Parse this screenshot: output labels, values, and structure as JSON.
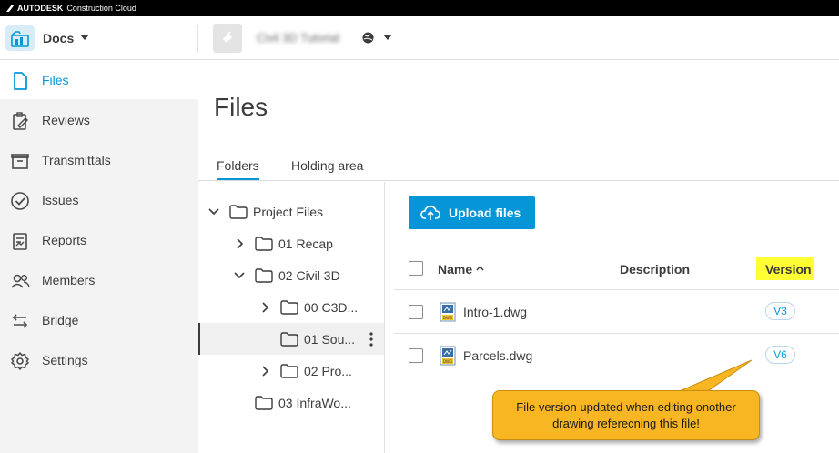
{
  "topbar": {
    "brand": "AUTODESK",
    "product": "Construction Cloud"
  },
  "header": {
    "module": "Docs",
    "project": "Civil 3D Tutorial"
  },
  "sidebar": {
    "items": [
      {
        "label": "Files",
        "icon": "file-icon",
        "active": true
      },
      {
        "label": "Reviews",
        "icon": "reviews-icon"
      },
      {
        "label": "Transmittals",
        "icon": "transmittals-icon"
      },
      {
        "label": "Issues",
        "icon": "issues-icon"
      },
      {
        "label": "Reports",
        "icon": "reports-icon"
      },
      {
        "label": "Members",
        "icon": "members-icon"
      },
      {
        "label": "Bridge",
        "icon": "bridge-icon"
      },
      {
        "label": "Settings",
        "icon": "settings-icon"
      }
    ]
  },
  "main": {
    "title": "Files",
    "tabs": [
      {
        "label": "Folders",
        "active": true
      },
      {
        "label": "Holding area"
      }
    ],
    "upload_label": "Upload files"
  },
  "tree": [
    {
      "label": "Project Files",
      "expanded": true
    },
    {
      "label": "01 Recap",
      "expanded": false
    },
    {
      "label": "02 Civil 3D",
      "expanded": true
    },
    {
      "label": "00 C3D...",
      "expanded": false
    },
    {
      "label": "01 Sou...",
      "selected": true
    },
    {
      "label": "02 Pro...",
      "expanded": false
    },
    {
      "label": "03 InfraWo..."
    }
  ],
  "table": {
    "columns": {
      "name": "Name",
      "description": "Description",
      "version": "Version"
    },
    "rows": [
      {
        "name": "Intro-1.dwg",
        "version": "V3"
      },
      {
        "name": "Parcels.dwg",
        "version": "V6"
      }
    ]
  },
  "callout": {
    "text": "File version updated when editing onother drawing referecning this file!"
  },
  "colors": {
    "accent": "#0696d7",
    "highlight": "#ffff33",
    "callout": "#f8b722"
  }
}
